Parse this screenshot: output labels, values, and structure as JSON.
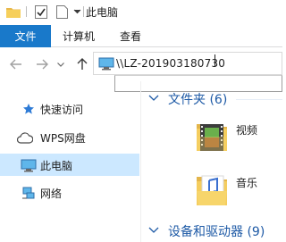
{
  "titlebar": {
    "title": "此电脑",
    "icons": [
      "folder-icon",
      "checkmark-properties-icon",
      "new-folder-icon",
      "customize-toolbar-chevron-icon"
    ]
  },
  "ribbon": {
    "file_tab": "文件",
    "tabs": [
      "计算机",
      "查看"
    ],
    "accent_color": "#1979ca"
  },
  "navbar": {
    "address": "\\\\LZ-201903180730"
  },
  "nav_pane": {
    "items": [
      {
        "label": "快速访问",
        "icon": "pin-star-icon"
      },
      {
        "label": "WPS网盘",
        "icon": "cloud-icon"
      },
      {
        "label": "此电脑",
        "icon": "computer-icon",
        "selected": true
      },
      {
        "label": "网络",
        "icon": "network-icon"
      }
    ]
  },
  "content": {
    "groups": [
      {
        "title": "文件夹 (6)"
      },
      {
        "title": "设备和驱动器 (9)"
      }
    ],
    "folders": [
      {
        "label": "视频",
        "icon": "video-folder-icon"
      },
      {
        "label": "音乐",
        "icon": "music-folder-icon"
      }
    ]
  }
}
